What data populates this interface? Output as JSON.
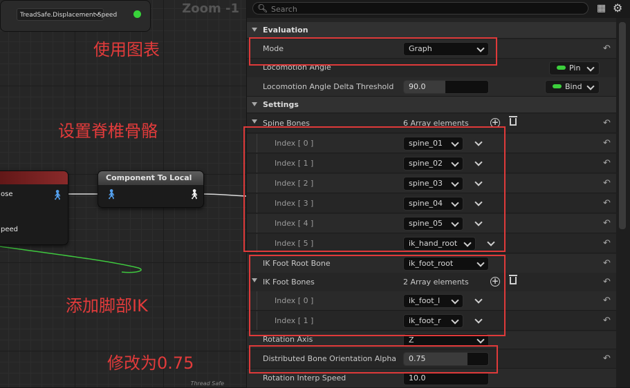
{
  "graph": {
    "zoom_label": "Zoom -1",
    "pose_node": {
      "line1": "ose",
      "line2": "peed"
    },
    "component_node": {
      "title": "Component To Local"
    },
    "thread_node": {
      "pill": "TreadSafe.Displacement Speed",
      "tag": "Thread Safe"
    },
    "annotations": {
      "use_graph": "使用图表",
      "set_spine": "设置脊椎骨骼",
      "add_foot_ik": "添加脚部IK",
      "change_to": "修改为0.75"
    }
  },
  "search": {
    "placeholder": "Search"
  },
  "evaluation": {
    "title": "Evaluation",
    "mode": {
      "label": "Mode",
      "value": "Graph"
    },
    "loco_angle": {
      "label": "Locomotion Angle",
      "button": "Pin"
    },
    "loco_delta": {
      "label": "Locomotion Angle Delta Threshold",
      "value": "90.0",
      "button": "Bind"
    }
  },
  "settings": {
    "title": "Settings",
    "spine_bones": {
      "label": "Spine Bones",
      "count": "6 Array elements",
      "items": [
        {
          "index": "Index [ 0 ]",
          "value": "spine_01"
        },
        {
          "index": "Index [ 1 ]",
          "value": "spine_02"
        },
        {
          "index": "Index [ 2 ]",
          "value": "spine_03"
        },
        {
          "index": "Index [ 3 ]",
          "value": "spine_04"
        },
        {
          "index": "Index [ 4 ]",
          "value": "spine_05"
        },
        {
          "index": "Index [ 5 ]",
          "value": "ik_hand_root"
        }
      ]
    },
    "ik_foot_root": {
      "label": "IK Foot Root Bone",
      "value": "ik_foot_root"
    },
    "ik_foot_bones": {
      "label": "IK Foot Bones",
      "count": "2 Array elements",
      "items": [
        {
          "index": "Index [ 0 ]",
          "value": "ik_foot_l"
        },
        {
          "index": "Index [ 1 ]",
          "value": "ik_foot_r"
        }
      ]
    },
    "rotation_axis": {
      "label": "Rotation Axis",
      "value": "Z"
    },
    "distributed_alpha": {
      "label": "Distributed Bone Orientation Alpha",
      "value": "0.75",
      "fill": 0.75
    },
    "rotation_interp": {
      "label": "Rotation Interp Speed",
      "value": "10.0"
    }
  },
  "colors": {
    "annotation": "#e23b3b",
    "led": "#3ccf3c",
    "pin_blue": "#54a0ee"
  },
  "icons": [
    "search-icon",
    "grid-icon",
    "gear-icon",
    "reset-arrow-icon",
    "add-element-icon",
    "trash-icon",
    "person-pin-icon",
    "chevron-down-icon"
  ]
}
